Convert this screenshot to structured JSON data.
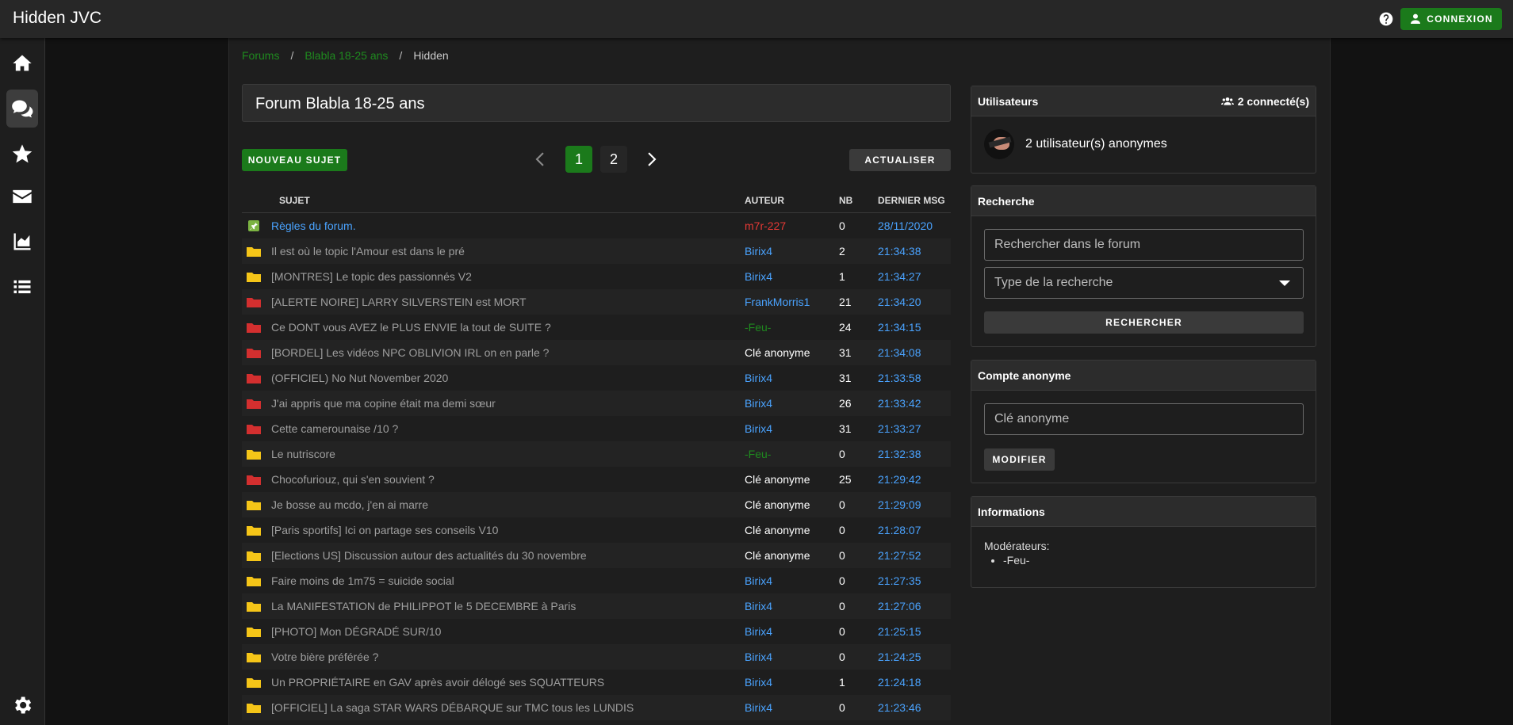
{
  "app": {
    "title": "Hidden JVC"
  },
  "header": {
    "icons": [
      "help-circle-icon",
      "database-icon",
      "github-icon"
    ],
    "login_label": "CONNEXION",
    "colors": {
      "accent": "#1b7a1b",
      "link": "#4aa3ff",
      "admin": "#e53935"
    }
  },
  "sidebar": {
    "items": [
      {
        "icon": "home-icon",
        "active": false
      },
      {
        "icon": "forum-icon",
        "active": true
      },
      {
        "icon": "star-icon",
        "active": false
      },
      {
        "icon": "mail-icon",
        "active": false
      },
      {
        "icon": "chart-icon",
        "active": false
      },
      {
        "icon": "list-icon",
        "active": false
      }
    ],
    "footer_icon": "settings-icon"
  },
  "breadcrumb": {
    "forums": "Forums",
    "forum": "Blabla 18-25 ans",
    "current": "Hidden",
    "separator": "/"
  },
  "forum": {
    "title": "Forum Blabla 18-25 ans"
  },
  "toolbar": {
    "new_topic": "NOUVEAU SUJET",
    "refresh": "ACTUALISER"
  },
  "pagination": {
    "pages": [
      "1",
      "2"
    ],
    "current": "1"
  },
  "table": {
    "headers": {
      "subject": "SUJET",
      "author": "AUTEUR",
      "count": "NB",
      "last": "DERNIER MSG"
    },
    "rows": [
      {
        "icon": "pinned",
        "subject": "Règles du forum.",
        "author": "m7r-227",
        "author_role": "admin",
        "count": "0",
        "last": "28/11/2020"
      },
      {
        "icon": "folder-yellow",
        "subject": "Il est où le topic l'Amour est dans le pré",
        "author": "Birix4",
        "author_role": "user",
        "count": "2",
        "last": "21:34:38"
      },
      {
        "icon": "folder-yellow",
        "subject": "[MONTRES] Le topic des passionnés V2",
        "author": "Birix4",
        "author_role": "user",
        "count": "1",
        "last": "21:34:27"
      },
      {
        "icon": "folder-red",
        "subject": "[ALERTE NOIRE] LARRY SILVERSTEIN est MORT",
        "author": "FrankMorris1",
        "author_role": "user",
        "count": "21",
        "last": "21:34:20"
      },
      {
        "icon": "folder-red",
        "subject": "Ce DONT vous AVEZ le PLUS ENVIE la tout de SUITE ?",
        "author": "-Feu-",
        "author_role": "moderator",
        "count": "24",
        "last": "21:34:15"
      },
      {
        "icon": "folder-red",
        "subject": "[BORDEL] Les vidéos NPC OBLIVION IRL on en parle ?",
        "author": "Clé anonyme",
        "author_role": "anon",
        "count": "31",
        "last": "21:34:08"
      },
      {
        "icon": "folder-red",
        "subject": "(OFFICIEL) No Nut November 2020",
        "author": "Birix4",
        "author_role": "user",
        "count": "31",
        "last": "21:33:58"
      },
      {
        "icon": "folder-red",
        "subject": "J'ai appris que ma copine était ma demi sœur",
        "author": "Birix4",
        "author_role": "user",
        "count": "26",
        "last": "21:33:42"
      },
      {
        "icon": "folder-red",
        "subject": "Cette camerounaise /10 ?",
        "author": "Birix4",
        "author_role": "user",
        "count": "31",
        "last": "21:33:27"
      },
      {
        "icon": "folder-yellow",
        "subject": "Le nutriscore",
        "author": "-Feu-",
        "author_role": "moderator",
        "count": "0",
        "last": "21:32:38"
      },
      {
        "icon": "folder-red",
        "subject": "Chocofuriouz, qui s'en souvient ?",
        "author": "Clé anonyme",
        "author_role": "anon",
        "count": "25",
        "last": "21:29:42"
      },
      {
        "icon": "folder-yellow",
        "subject": "Je bosse au mcdo, j'en ai marre",
        "author": "Clé anonyme",
        "author_role": "anon",
        "count": "0",
        "last": "21:29:09"
      },
      {
        "icon": "folder-yellow",
        "subject": "[Paris sportifs] Ici on partage ses conseils V10",
        "author": "Clé anonyme",
        "author_role": "anon",
        "count": "0",
        "last": "21:28:07"
      },
      {
        "icon": "folder-yellow",
        "subject": "[Elections US] Discussion autour des actualités du 30 novembre",
        "author": "Clé anonyme",
        "author_role": "anon",
        "count": "0",
        "last": "21:27:52"
      },
      {
        "icon": "folder-yellow",
        "subject": "Faire moins de 1m75 = suicide social",
        "author": "Birix4",
        "author_role": "user",
        "count": "0",
        "last": "21:27:35"
      },
      {
        "icon": "folder-yellow",
        "subject": "La MANIFESTATION de PHILIPPOT le 5 DECEMBRE à Paris",
        "author": "Birix4",
        "author_role": "user",
        "count": "0",
        "last": "21:27:06"
      },
      {
        "icon": "folder-yellow",
        "subject": "[PHOTO] Mon DÉGRADÉ SUR/10",
        "author": "Birix4",
        "author_role": "user",
        "count": "0",
        "last": "21:25:15"
      },
      {
        "icon": "folder-yellow",
        "subject": "Votre bière préférée ?",
        "author": "Birix4",
        "author_role": "user",
        "count": "0",
        "last": "21:24:25"
      },
      {
        "icon": "folder-yellow",
        "subject": "Un PROPRIÉTAIRE en GAV après avoir délogé ses SQUATTEURS",
        "author": "Birix4",
        "author_role": "user",
        "count": "1",
        "last": "21:24:18"
      },
      {
        "icon": "folder-yellow",
        "subject": "[OFFICIEL] La saga STAR WARS DÉBARQUE sur TMC tous les LUNDIS",
        "author": "Birix4",
        "author_role": "user",
        "count": "0",
        "last": "21:23:46"
      }
    ]
  },
  "users_card": {
    "title": "Utilisateurs",
    "connected": "2 connecté(s)",
    "anonymous": "2 utilisateur(s) anonymes"
  },
  "search_card": {
    "title": "Recherche",
    "placeholder": "Rechercher dans le forum",
    "type_placeholder": "Type de la recherche",
    "button": "RECHERCHER"
  },
  "account_card": {
    "title": "Compte anonyme",
    "placeholder": "Clé anonyme",
    "button": "MODIFIER"
  },
  "info_card": {
    "title": "Informations",
    "moderators_label": "Modérateurs:",
    "moderators": [
      "-Feu-"
    ]
  }
}
